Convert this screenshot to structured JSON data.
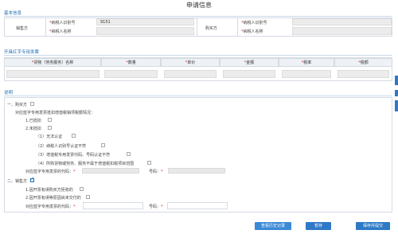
{
  "page": {
    "title": "申请信息"
  },
  "basic": {
    "section_label": "基本信息",
    "seller_label": "销售方",
    "buyer_label": "购买方",
    "taxpayer_id_label": "纳税人识别号",
    "taxpayer_name_label": "纳税人名称",
    "seller_taxpayer_id_value": "9151"
  },
  "invoice": {
    "section_label": "开具红字专用发票",
    "columns": [
      "货物（劳务服务）名称",
      "数量",
      "单价",
      "金额",
      "税率",
      "税额"
    ]
  },
  "notes": {
    "section_label": "说明",
    "buyer_heading": "一、购买方",
    "buyer_deduction_q": "对应蓝字专用发票抵扣增值税销项税额情况：",
    "deducted": "1.已抵扣",
    "not_deducted": "2.未抵扣",
    "reason1": "（1）无法认证",
    "reason2": "（2）纳税人识别号认证不符",
    "reason3": "（3）增值税专用发票代码、号码认证不符",
    "reason4": "（4）所购货物或劳务、服务不属于增值税扣税项目范围",
    "buyer_code_label": "对应蓝字专用发票的代码：",
    "buyer_number_label": "号码：",
    "seller_heading": "二、销售方",
    "seller_reason1": "1.因开票有误购买方拒收的",
    "seller_reason2": "2.因开票有误等原因尚未交付的",
    "seller_code_label": "对应蓝字专用发票的代码：",
    "seller_number_label": "号码：",
    "required_mark": "*"
  },
  "state": {
    "buyer_checked": false,
    "deducted_checked": false,
    "not_deducted_checked": false,
    "reason1_checked": false,
    "reason2_checked": false,
    "reason3_checked": false,
    "reason4_checked": false,
    "seller_checked": true,
    "seller_reason1_checked": false,
    "seller_reason2_checked": false
  },
  "buttons": {
    "history": "查看历史记录",
    "save": "暂存",
    "save_submit": "保存并提交"
  },
  "colors": {
    "accent": "#2e79c6",
    "section": "#1f6fb5",
    "required": "#e02020"
  }
}
